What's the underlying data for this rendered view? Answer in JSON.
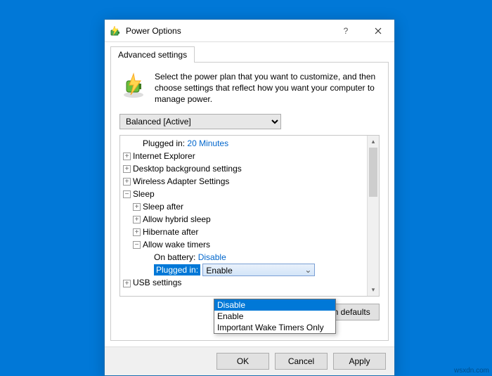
{
  "window": {
    "title": "Power Options"
  },
  "tabs": {
    "active": "Advanced settings"
  },
  "header": {
    "text": "Select the power plan that you want to customize, and then choose settings that reflect how you want your computer to manage power."
  },
  "plan_select": {
    "value": "Balanced [Active]"
  },
  "tree": {
    "plugged_label": "Plugged in:",
    "plugged_value": "20 Minutes",
    "ie": "Internet Explorer",
    "desktop_bg": "Desktop background settings",
    "wireless": "Wireless Adapter Settings",
    "sleep": "Sleep",
    "sleep_after": "Sleep after",
    "hybrid": "Allow hybrid sleep",
    "hibernate": "Hibernate after",
    "wake_timers": "Allow wake timers",
    "on_battery_label": "On battery:",
    "on_battery_value": "Disable",
    "plugged_in_label": "Plugged in:",
    "plugged_in_select": "Enable",
    "usb": "USB settings"
  },
  "dropdown": {
    "opt0": "Disable",
    "opt1": "Enable",
    "opt2": "Important Wake Timers Only"
  },
  "buttons": {
    "restore": "Restore plan defaults",
    "ok": "OK",
    "cancel": "Cancel",
    "apply": "Apply"
  },
  "watermark": "wsxdn.com"
}
